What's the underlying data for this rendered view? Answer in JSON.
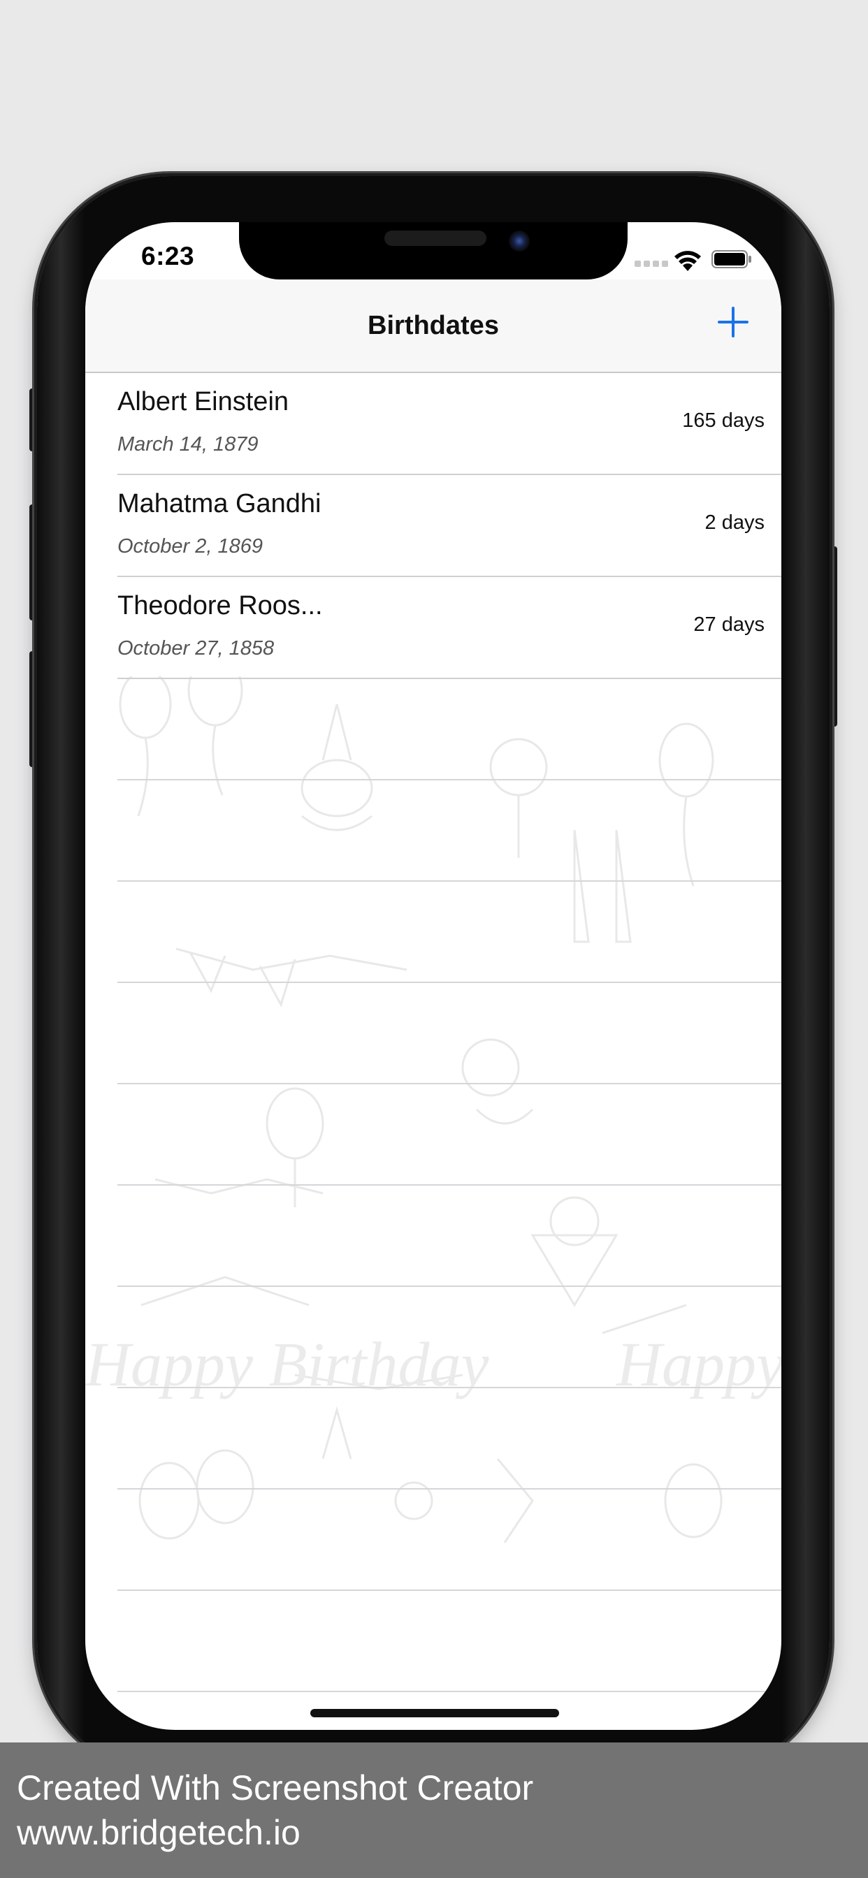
{
  "status_bar": {
    "time": "6:23"
  },
  "nav": {
    "title": "Birthdates",
    "add_icon": "plus-icon"
  },
  "people": [
    {
      "name": "Albert Einstein",
      "date": "March 14, 1879",
      "days": "165 days"
    },
    {
      "name": "Mahatma Gandhi",
      "date": "October 2, 1869",
      "days": "2 days"
    },
    {
      "name": "Theodore Roos...",
      "date": "October 27, 1858",
      "days": "27 days"
    }
  ],
  "background_art": {
    "text": "Happy Birthday"
  },
  "colors": {
    "accent": "#1a73e8",
    "footer": "#737373"
  },
  "footer": {
    "line1": "Created With Screenshot Creator",
    "line2": "www.bridgetech.io"
  }
}
